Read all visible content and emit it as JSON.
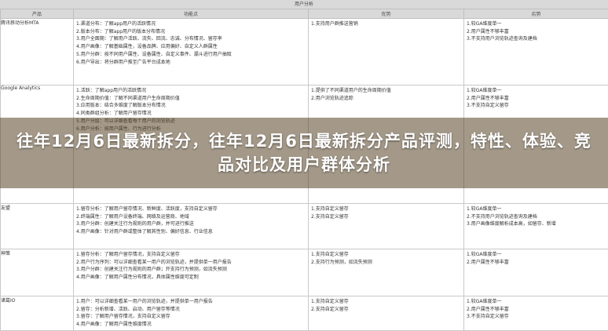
{
  "table_title": "用户分析",
  "headers": [
    "产品",
    "功能点",
    "优势",
    "劣势"
  ],
  "rows": [
    {
      "product": "腾讯移动分析MTA",
      "features": [
        "1.渠道分布：了解app用户的活跃情况",
        "2.版本分布：了解app用户的版本分布情况",
        "3.用户全面期：了解用户活跃、流失、回流、忠诚、分布情况、留存率",
        "4.用户画像：了解基础属性，设备品牌、应用偏好、自定义人群属性",
        "5.用户分群：按不同用户属性、设备属性、自定义事件、漏斗进行用户抽取",
        "6.用户导出：将分群用户推至广告平台成本地"
      ],
      "pros": [
        "1.支持用户群推送营销"
      ],
      "cons": [
        "1.较GA维度单一",
        "2.用户属性不够丰富",
        "3.不支持用户浏览轨迹查询及建档"
      ]
    },
    {
      "product": "Google Analytics",
      "features": [
        "1.活跃：了解app用户的活跃情况",
        "2.生命周期价值：了解不同渠道用户生命周期价值",
        "3.应用版本：结合多维度了解版本分布情况",
        "4.同类群组分析：了解用户留存情况",
        "5.用户分层：可以详细查看每个用户的浏览轨迹",
        "6.用户分析：按用户属性、行为进行分析"
      ],
      "pros": [
        "1.提供了不同渠道用户的生命周期价值",
        "2.用户浏览轨迹追踪"
      ],
      "cons": [
        "1.较GA维度单一",
        "2.用户属性不够丰富",
        "3.不支持自定义留存"
      ]
    },
    {
      "product": "友盟",
      "features": [
        "1.留存分析：了解用户留存情况、新鲜度、活跃度，支持自定义留存",
        "2.终端属性：了解用户设备终端、网络及运营商、地域",
        "3.用户分群：创建关注行为规则的用户群，并可进行推送",
        "4.用户画像：针对用户群或整体了解其性别、偏好信息、行业信息"
      ],
      "pros": [
        "1.支持自定义留存",
        "2.支持自定义留存"
      ],
      "cons": [
        "1.较GA维度单一",
        "2.不支持用户浏览轨迹查询及建档",
        "3.用户画像维度解析成本高，如留存、新增"
      ]
    },
    {
      "product": "神策",
      "features": [
        "1.留存分析：了解用户留存情况，支持自定义留存",
        "2.用户行为序列：可以详细查看某一用户的浏览轨迹，并提供单一用户报告",
        "3.用户分群：创建关注行为规则的用户群；开支持行为预测，如流失预测",
        "4.用户画像：了解用户属性分布情况，具体属性维度可定制"
      ],
      "pros": [
        "1.支持自定义留存",
        "2.支持行为预测，如流失预测"
      ],
      "cons": [
        "1.较GA维度单一",
        "2.用户属性不够丰富"
      ]
    },
    {
      "product": "诸葛IO",
      "features": [
        "1.用户：可以详细查看某一用户的浏览轨迹，并提供单一用户报告",
        "2.留存：分析新增、活跃、启动、用户留存等情况",
        "3.留存：了解用户留存情况，支持自定义留存",
        "4.用户画像：了解用户属性维度情况"
      ],
      "pros": [
        "1.支持自定义留存",
        "2.支持自定义留存"
      ],
      "cons": [
        "1.较GA维度单一",
        "2.用户属性不够丰富",
        "3.不支持自定义留存"
      ]
    }
  ],
  "overlay_title": "往年12月6日最新拆分，往年12月6日最新拆分产品评测，特性、体验、竞品对比及用户群体分析",
  "colors": {
    "header_bg": "#d9d9d9",
    "overlay_bg": "#5a4628"
  }
}
